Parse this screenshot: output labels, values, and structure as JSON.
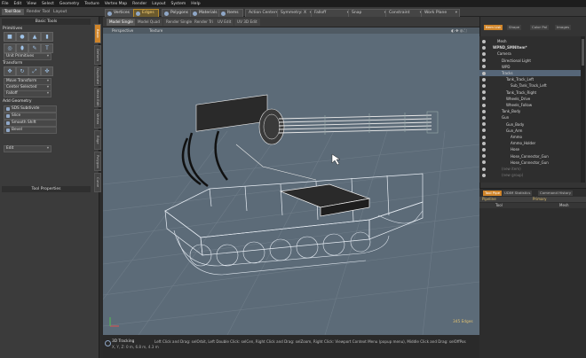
{
  "menu": [
    "File",
    "Edit",
    "View",
    "Select",
    "Geometry",
    "Texture",
    "Vertex Map",
    "Render",
    "Layout",
    "System",
    "Help"
  ],
  "top_tabs": [
    {
      "label": "Tool Box",
      "active": true
    },
    {
      "label": "Render Tool",
      "active": false
    },
    {
      "label": "Layout",
      "active": false
    }
  ],
  "toolbar": {
    "vertices": "Vertices",
    "edges": "Edges",
    "polygons": "Polygons",
    "materials": "Materials",
    "items": "Items",
    "action_center": "Action Center",
    "symmetry": "Symmetry: X",
    "falloff": "Falloff",
    "snap": "Snap",
    "constraint": "Constraint",
    "work_plane": "Work Plane"
  },
  "left": {
    "header": "Basic Tools",
    "primitives": "Primitives",
    "transform": "Transform",
    "add_geometry": "Add Geometry",
    "unit_primitives": "Unit Primitives",
    "move_transform": "Move Transform",
    "center_selected": "Center Selected",
    "falloff": "Falloff",
    "sds_subdivide": "SDS Subdivide",
    "slice": "Slice",
    "smooth_shift": "Smooth Shift",
    "bevel": "Bevel",
    "edit": "Edit",
    "tool_properties": "Tool Properties",
    "vtabs": [
      "Basic",
      "Deform",
      "Duplicate",
      "Mesh Edit",
      "Vertex",
      "Edge",
      "Polygon",
      "Curve",
      "Sculpt",
      "Paint"
    ]
  },
  "viewport": {
    "tabs": [
      "Model Single",
      "Model Quad",
      "Render Single",
      "Render Tri",
      "UV Edit",
      "UV 3D Edit"
    ],
    "view": "Perspective",
    "shading": "Texture",
    "counter": "345 Edges",
    "status_title": "3D Tracking",
    "status_coords": "X, Y, Z:  0 m, 6.8 m, 4.3 m",
    "status_hint": "Left Click and Drag: selOrbit,  Left Double Click: selCen,  Right Click and Drag: selZoom,  Right Click: Viewport Context Menu (popup menu),  Middle Click and Drag: selOffPos"
  },
  "right": {
    "tabs": [
      "Item List",
      "Shape",
      "Color Pal",
      "Images"
    ],
    "items": [
      {
        "label": "Mesh",
        "indent": 2,
        "sel": false
      },
      {
        "label": "WPND_SMNItem*",
        "indent": 1,
        "sel": false,
        "bold": true
      },
      {
        "label": "Camera",
        "indent": 2,
        "sel": false
      },
      {
        "label": "Directional Light",
        "indent": 3,
        "sel": false
      },
      {
        "label": "WPD",
        "indent": 3,
        "sel": false
      },
      {
        "label": "Tracks",
        "indent": 3,
        "sel": true
      },
      {
        "label": "Tank_Track_Left",
        "indent": 4,
        "sel": false
      },
      {
        "label": "Sub_Tank_Track_Left",
        "indent": 5,
        "sel": false
      },
      {
        "label": "Tank_Track_Right",
        "indent": 4,
        "sel": false
      },
      {
        "label": "Wheels_Drive",
        "indent": 4,
        "sel": false
      },
      {
        "label": "Wheels_Follow",
        "indent": 4,
        "sel": false
      },
      {
        "label": "Tank_Body",
        "indent": 3,
        "sel": false
      },
      {
        "label": "Gun",
        "indent": 3,
        "sel": false
      },
      {
        "label": "Gun_Body",
        "indent": 4,
        "sel": false
      },
      {
        "label": "Gun_Arm",
        "indent": 4,
        "sel": false
      },
      {
        "label": "Ammo",
        "indent": 5,
        "sel": false
      },
      {
        "label": "Ammo_Holder",
        "indent": 5,
        "sel": false
      },
      {
        "label": "Hose",
        "indent": 5,
        "sel": false
      },
      {
        "label": "Hose_Connector_Gun",
        "indent": 5,
        "sel": false
      },
      {
        "label": "Hose_Connector_Gun",
        "indent": 5,
        "sel": false
      },
      {
        "label": "(new item)",
        "indent": 3,
        "sel": false,
        "ghost": true
      },
      {
        "label": "(new group)",
        "indent": 3,
        "sel": false,
        "ghost": true
      }
    ],
    "lower_tabs": [
      "Tool Pipe",
      "UDIM Statistics",
      "Command History"
    ],
    "shader_hdr": {
      "col1": "Pipeline",
      "col2": "Primary"
    },
    "shader_row": {
      "col1": "Tool",
      "col2": "Mesh"
    }
  },
  "colors": {
    "accent": "#d0852a",
    "selection": "#566678",
    "viewport_bg": "#5c6b78"
  }
}
